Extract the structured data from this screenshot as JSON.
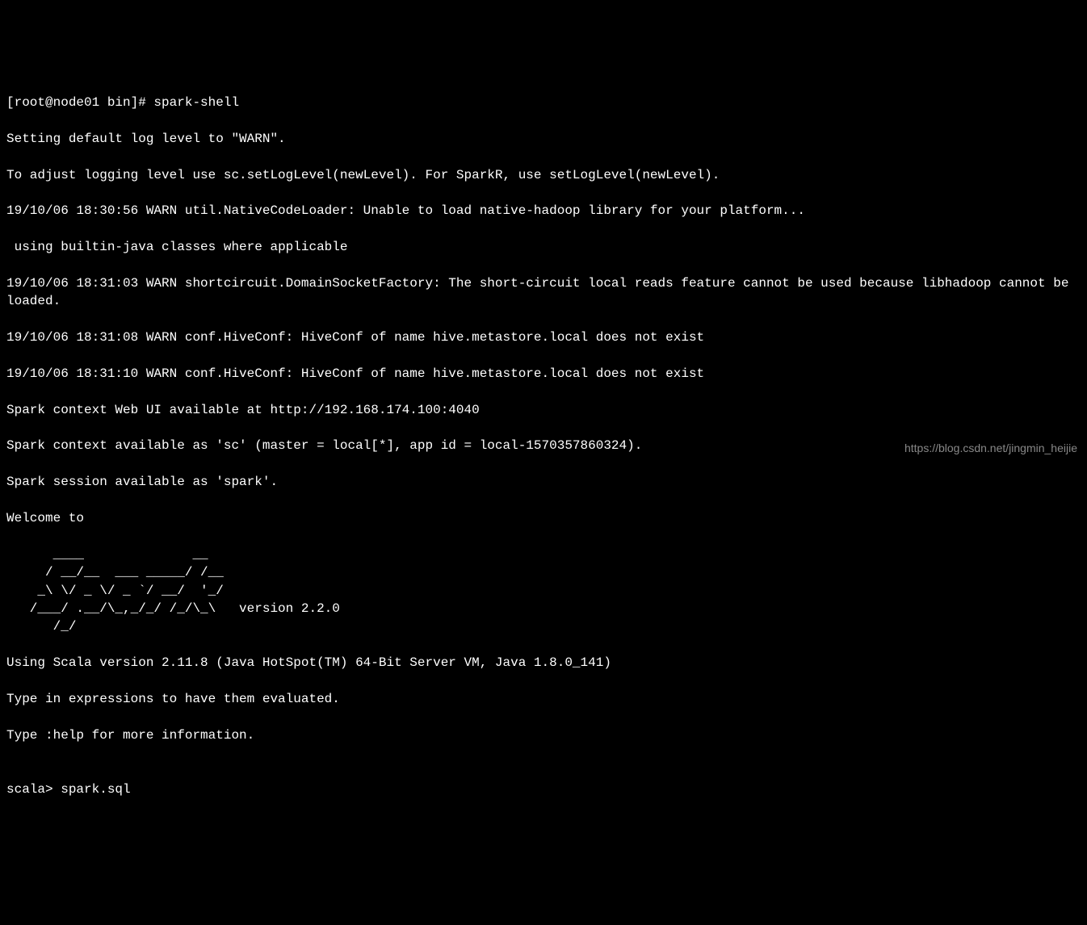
{
  "terminal": {
    "prompt_line": "[root@node01 bin]# spark-shell",
    "log_lines": [
      "Setting default log level to \"WARN\".",
      "To adjust logging level use sc.setLogLevel(newLevel). For SparkR, use setLogLevel(newLevel).",
      "19/10/06 18:30:56 WARN util.NativeCodeLoader: Unable to load native-hadoop library for your platform...",
      " using builtin-java classes where applicable",
      "19/10/06 18:31:03 WARN shortcircuit.DomainSocketFactory: The short-circuit local reads feature cannot be used because libhadoop cannot be loaded.",
      "19/10/06 18:31:08 WARN conf.HiveConf: HiveConf of name hive.metastore.local does not exist",
      "19/10/06 18:31:10 WARN conf.HiveConf: HiveConf of name hive.metastore.local does not exist",
      "Spark context Web UI available at http://192.168.174.100:4040",
      "Spark context available as 'sc' (master = local[*], app id = local-1570357860324).",
      "Spark session available as 'spark'.",
      "Welcome to"
    ],
    "ascii_art": "      ____              __\n     / __/__  ___ _____/ /__\n    _\\ \\/ _ \\/ _ `/ __/  '_/\n   /___/ .__/\\_,_/_/ /_/\\_\\   version 2.2.0\n      /_/\n",
    "footer_lines": [
      "Using Scala version 2.11.8 (Java HotSpot(TM) 64-Bit Server VM, Java 1.8.0_141)",
      "Type in expressions to have them evaluated.",
      "Type :help for more information.",
      ""
    ],
    "scala_prompt": "scala> ",
    "scala_input": "spark.sql"
  },
  "watermark": "https://blog.csdn.net/jingmin_heijie"
}
